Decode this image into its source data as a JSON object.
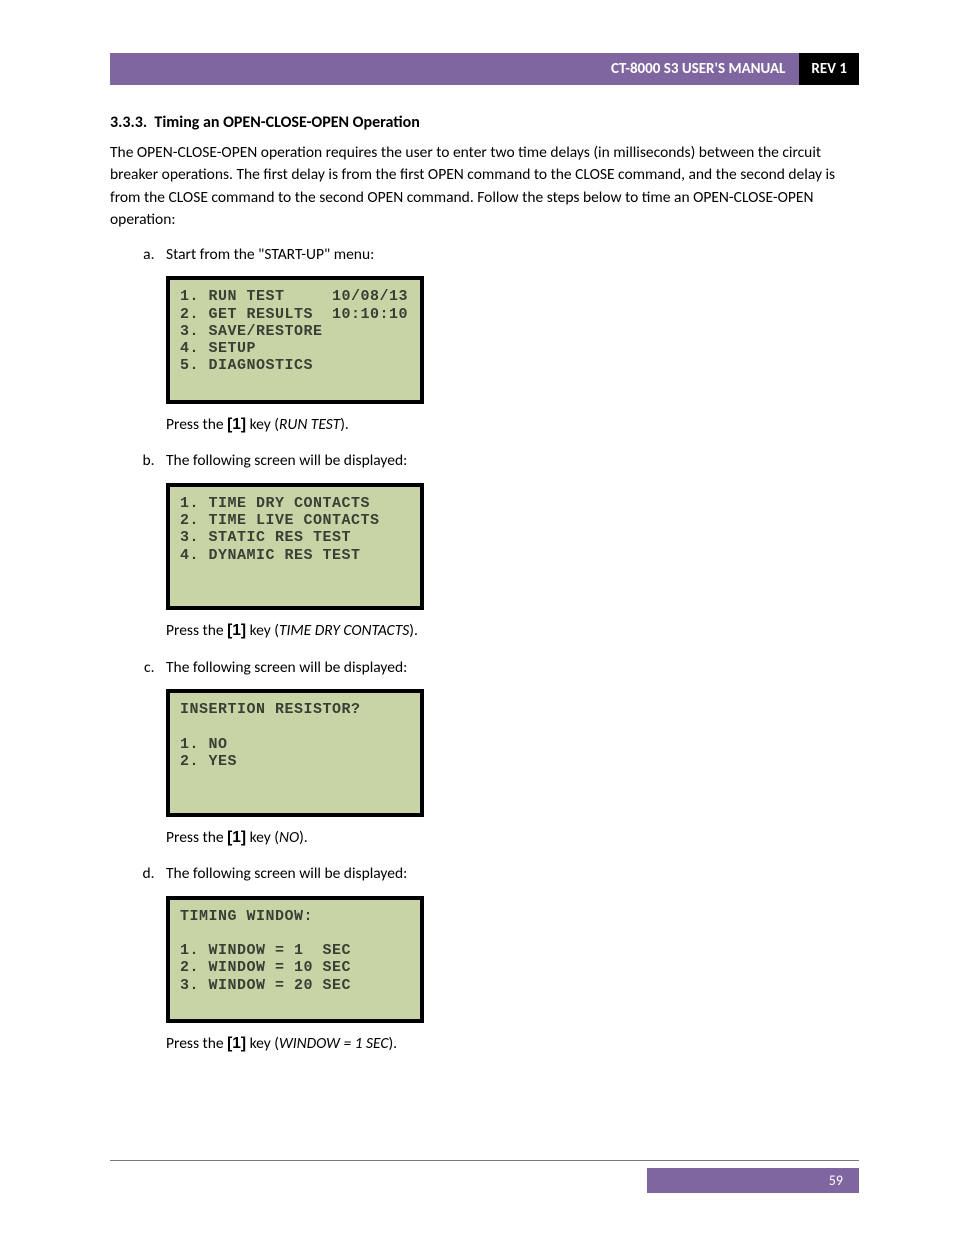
{
  "header": {
    "title": "CT-8000 S3 USER'S MANUAL",
    "rev": "REV 1"
  },
  "section": {
    "number": "3.3.3.",
    "title": "Timing an OPEN-CLOSE-OPEN Operation"
  },
  "intro": "The OPEN-CLOSE-OPEN operation requires the user to enter two time delays (in milliseconds) between the circuit breaker operations. The first delay is from the first OPEN command to the CLOSE command, and the second delay is from the CLOSE command to the second OPEN command. Follow the steps below to time an OPEN-CLOSE-OPEN operation:",
  "steps": {
    "a": {
      "text": "Start from the \"START-UP\" menu:",
      "screen": "1. RUN TEST     10/08/13\n2. GET RESULTS  10:10:10\n3. SAVE/RESTORE\n4. SETUP\n5. DIAGNOSTICS\n\n",
      "after_pre": "Press the ",
      "after_key": "[1]",
      "after_mid": " key (",
      "after_em": "RUN TEST",
      "after_post": ")."
    },
    "b": {
      "text": "The following screen will be displayed:",
      "screen": "1. TIME DRY CONTACTS\n2. TIME LIVE CONTACTS\n3. STATIC RES TEST\n4. DYNAMIC RES TEST\n\n\n",
      "after_pre": "Press the ",
      "after_key": "[1]",
      "after_mid": " key (",
      "after_em": "TIME DRY CONTACTS",
      "after_post": ")."
    },
    "c": {
      "text": "The following screen will be displayed:",
      "screen": "INSERTION RESISTOR?\n\n1. NO\n2. YES\n\n\n",
      "after_pre": "Press the ",
      "after_key": "[1]",
      "after_mid": " key (",
      "after_em": "NO",
      "after_post": ")."
    },
    "d": {
      "text": "The following screen will be displayed:",
      "screen": "TIMING WINDOW:\n\n1. WINDOW = 1  SEC\n2. WINDOW = 10 SEC\n3. WINDOW = 20 SEC\n\n",
      "after_pre": "Press the ",
      "after_key": "[1]",
      "after_mid": " key (",
      "after_em": "WINDOW = 1 SEC",
      "after_post": ")."
    }
  },
  "footer": {
    "page_number": "59"
  }
}
